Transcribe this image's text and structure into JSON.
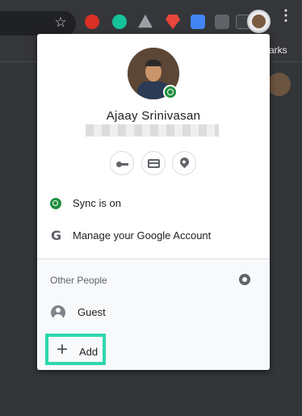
{
  "toolbar": {
    "bookmarks_partial": "arks",
    "star_glyph": "☆",
    "menu_glyph": "⋮",
    "extensions": [
      {
        "icon": "hand-stop-icon",
        "color": "#d93025"
      },
      {
        "icon": "grammarly-icon",
        "color": "#15c39a"
      },
      {
        "icon": "drive-icon",
        "color": "#9aa0a6"
      },
      {
        "icon": "superman-shield-icon",
        "color": "#e8453c"
      },
      {
        "icon": "reading-icon",
        "color": "#4285f4"
      },
      {
        "icon": "extension-gray-icon",
        "color": "#5f6368"
      },
      {
        "icon": "shield-outline-icon",
        "color": "#3c4043"
      }
    ]
  },
  "profile": {
    "name": "Ajaay Srinivasan",
    "quick_actions": [
      "passwords-key-icon",
      "payment-card-icon",
      "addresses-pin-icon"
    ]
  },
  "menu": {
    "sync_label": "Sync is on",
    "manage_label": "Manage your Google Account",
    "google_glyph": "G"
  },
  "other_people": {
    "title": "Other People",
    "guest_label": "Guest",
    "add_label": "Add",
    "add_glyph": "+"
  },
  "colors": {
    "sync_green": "#1e8e3e",
    "highlight": "#2fd7ae",
    "toolbar_bg": "#35363a"
  }
}
